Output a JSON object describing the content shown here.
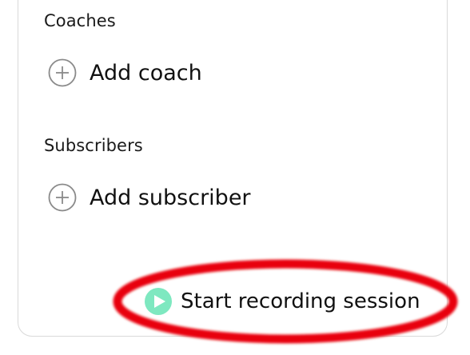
{
  "coaches": {
    "heading": "Coaches",
    "add_label": "Add coach"
  },
  "subscribers": {
    "heading": "Subscribers",
    "add_label": "Add subscriber"
  },
  "recording": {
    "start_label": "Start recording session"
  },
  "colors": {
    "highlight_ring": "#e8000b",
    "play_icon": "#7ee8c0",
    "plus_icon": "#8a8a8a"
  }
}
